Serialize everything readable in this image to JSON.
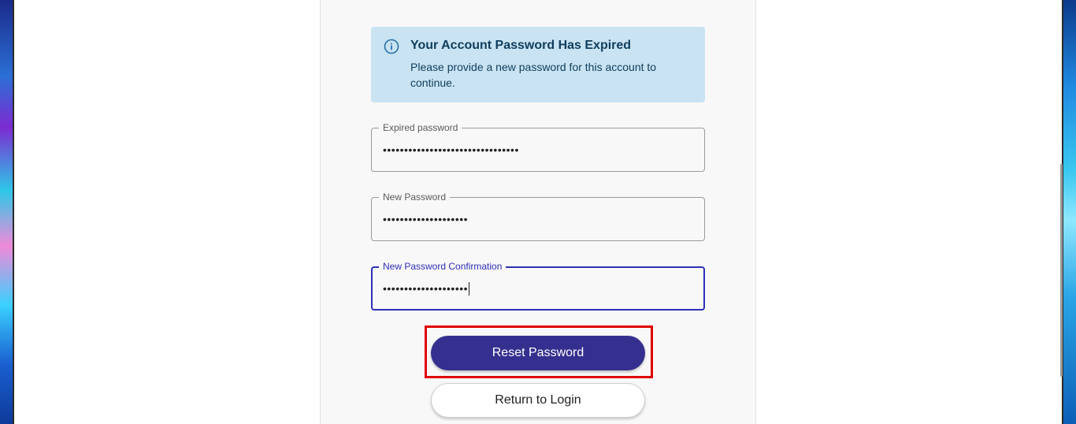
{
  "alert": {
    "icon": "info-circle-icon",
    "title": "Your Account Password Has Expired",
    "body": "Please provide a new password for this account to continue."
  },
  "form": {
    "expired_password": {
      "label": "Expired password",
      "value": "••••••••••••••••••••••••••••••••"
    },
    "new_password": {
      "label": "New Password",
      "value": "••••••••••••••••••••"
    },
    "new_password_confirmation": {
      "label": "New Password Confirmation",
      "value": "••••••••••••••••••••"
    }
  },
  "buttons": {
    "reset_label": "Reset Password",
    "return_label": "Return to Login"
  },
  "colors": {
    "primary": "#35308f",
    "focus": "#2f2fb7",
    "alert_bg": "#c9e3f2",
    "highlight": "#e00000"
  }
}
